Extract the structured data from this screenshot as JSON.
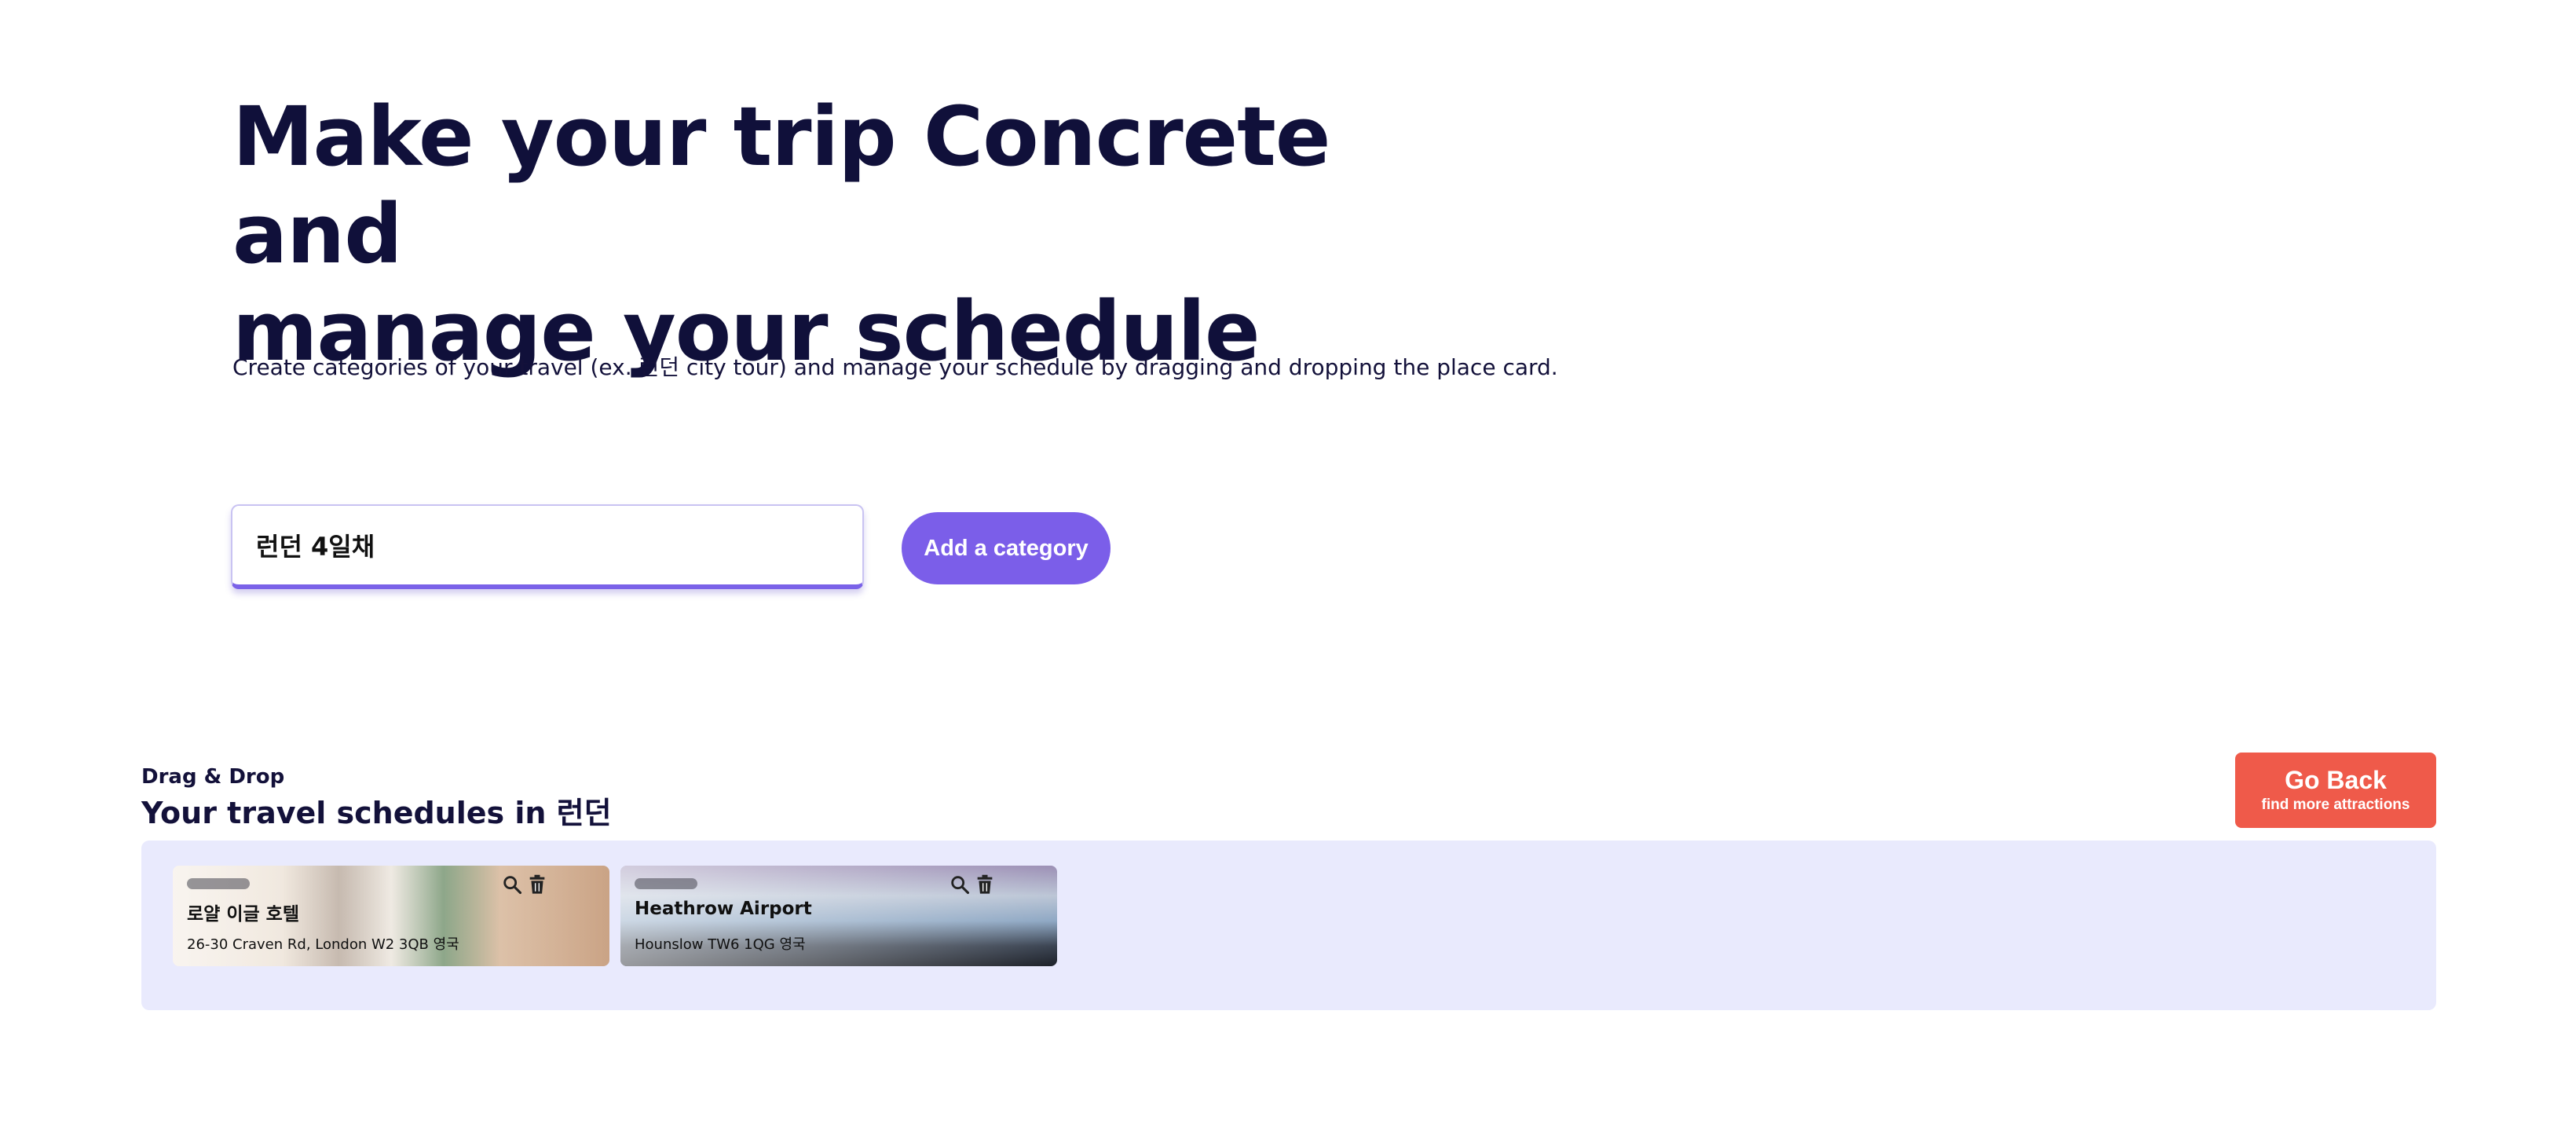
{
  "hero": {
    "title_line1": "Make your trip Concrete and",
    "title_line2": "manage your schedule",
    "description": "Create categories of your travel (ex. 런던 city tour) and manage your schedule by dragging and dropping the place card."
  },
  "category_form": {
    "input_value": "런던 4일채",
    "add_button_label": "Add a category"
  },
  "schedule_section": {
    "kicker": "Drag & Drop",
    "title": "Your travel schedules in 런던"
  },
  "go_back": {
    "label": "Go Back",
    "sublabel": "find more attractions",
    "color": "#ef5a4a"
  },
  "cards": [
    {
      "name": "로얄 이글 호텔",
      "address": "26-30 Craven Rd, London W2 3QB 영국",
      "icons": [
        "search-icon",
        "trash-icon"
      ]
    },
    {
      "name": "Heathrow Airport",
      "address": "Hounslow TW6 1QG 영국",
      "icons": [
        "search-icon",
        "trash-icon"
      ]
    }
  ],
  "colors": {
    "accent": "#7b5ee9",
    "board_background": "#e9eafd",
    "heading": "#10103a"
  }
}
